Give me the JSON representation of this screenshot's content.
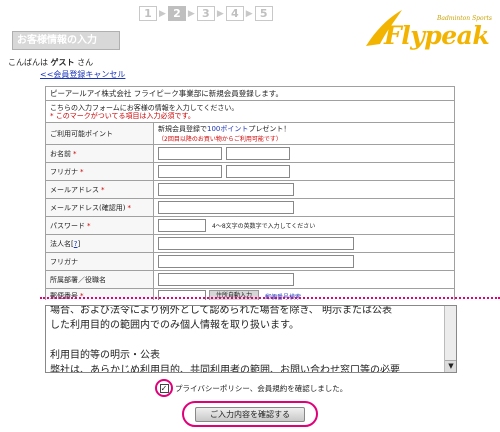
{
  "steps": [
    "1",
    "2",
    "3",
    "4",
    "5"
  ],
  "active_step": "2",
  "step_arrow": "▶",
  "logo": {
    "text": "Flypeak",
    "sub": "Badminton Sports",
    "color": "#f2b400"
  },
  "page_title": "お客様情報の入力",
  "greeting": {
    "prefix": "こんばんは",
    "name": "ゲスト",
    "suffix": "さん"
  },
  "cancel_link": "<<会員登録キャンセル",
  "form": {
    "header": "ピーアールアイ株式会社 フライピーク事業部に新規会員登録します。",
    "intro_line1": "こちらの入力フォームにお客様の情報を入力してください。",
    "intro_line2": "* このマークがついてる項目は入力必須です。",
    "points_label": "ご利用可能ポイント",
    "points_line1_a": "新規会員登録で",
    "points_line1_b": "100ポイント",
    "points_line1_c": "プレゼント！",
    "points_line2": "（2回目以降のお買い物からご利用可能です）",
    "fields": {
      "name": "お名前",
      "furigana": "フリガナ",
      "email": "メールアドレス",
      "email_confirm": "メールアドレス(確認用)",
      "password": "パスワード",
      "password_hint": "4〜8文字の英数字で入力してください",
      "corp": "法人名",
      "corp_help": "?",
      "corp_furigana": "フリガナ",
      "dept": "所属部署／役職名",
      "postal": "郵便番号",
      "postal_button": "住所自動入力",
      "postal_link": "郵便番号検索"
    },
    "required_mark": "*"
  },
  "terms": {
    "line1": "場合、および法令により例外として認められた場合を除き、 明示または公表",
    "line2": "した利用目的の範囲内でのみ個人情報を取り扱います。",
    "line3": "",
    "line4": "利用目的等の明示・公表",
    "line5": "弊社は、あらかじめ利用目的、共同利用者の範囲、お問い合わせ窓口等の必要"
  },
  "agree_text": "プライバシーポリシー、会員規約を確認しました。",
  "agree_checked": "✓",
  "submit_label": "ご入力内容を確認する",
  "scroll_down_glyph": "▼"
}
